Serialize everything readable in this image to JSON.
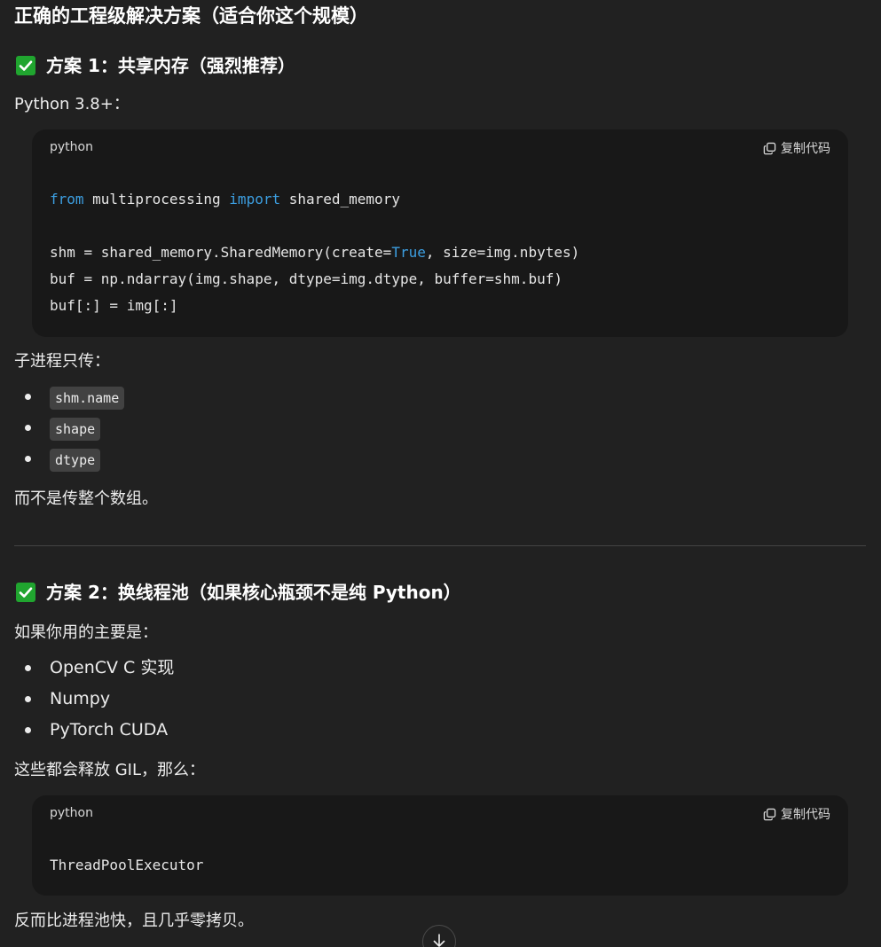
{
  "heading": "正确的工程级解决方案（适合你这个规模）",
  "section1": {
    "title": "方案 1：共享内存（强烈推荐）",
    "intro": "Python 3.8+：",
    "code": {
      "lang": "python",
      "copy_label": "复制代码",
      "kw_from": "from",
      "mod": " multiprocessing ",
      "kw_import": "import",
      "name": " shared_memory",
      "line2_pre": "shm = shared_memory.SharedMemory(create=",
      "line2_true": "True",
      "line2_post": ", size=img.nbytes)",
      "line3": "buf = np.ndarray(img.shape, dtype=img.dtype, buffer=shm.buf)",
      "line4": "buf[:] = img[:]"
    },
    "sub_intro": "子进程只传：",
    "items": [
      "shm.name",
      "shape",
      "dtype"
    ],
    "outro": "而不是传整个数组。"
  },
  "section2": {
    "title": "方案 2：换线程池（如果核心瓶颈不是纯 Python）",
    "intro": "如果你用的主要是：",
    "items": [
      "OpenCV C 实现",
      "Numpy",
      "PyTorch CUDA"
    ],
    "middle": "这些都会释放 GIL，那么：",
    "code": {
      "lang": "python",
      "copy_label": "复制代码",
      "line1": "ThreadPoolExecutor"
    },
    "outro": "反而比进程池快，且几乎零拷贝。"
  },
  "icons": {
    "check": "check-box-icon",
    "copy": "copy-icon",
    "scroll": "arrow-down-icon"
  },
  "colors": {
    "background": "#212121",
    "code_background": "#181818",
    "keyword": "#3c9ee0",
    "check_green": "#20a52f"
  }
}
